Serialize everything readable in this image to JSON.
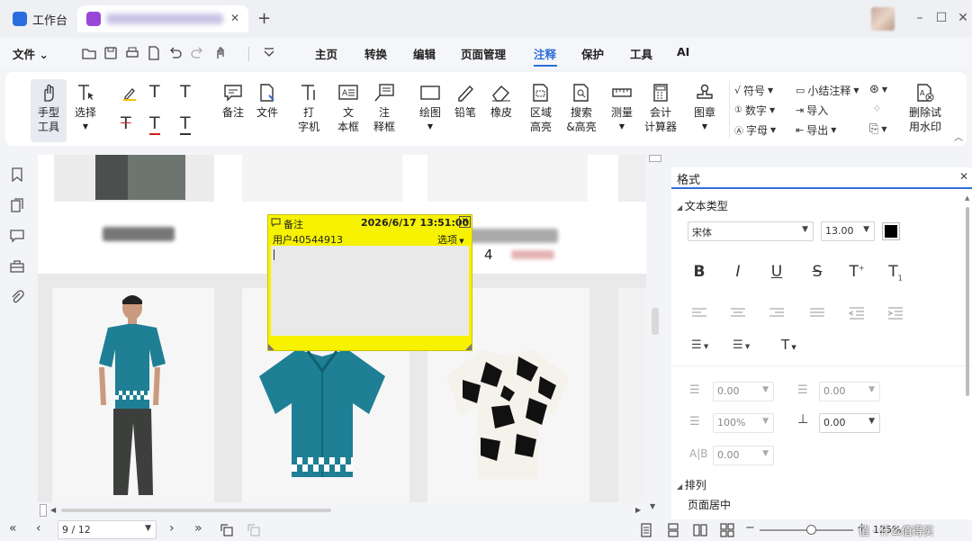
{
  "tabs": [
    {
      "label": "工作台",
      "active": false
    },
    {
      "label": "",
      "active": true,
      "close": "✕"
    }
  ],
  "new_tab": "+",
  "window": {
    "minimize": "–",
    "maximize": "☐",
    "close": "✕"
  },
  "menu": {
    "file": "文件",
    "items": [
      "主页",
      "转换",
      "编辑",
      "页面管理",
      "注释",
      "保护",
      "工具",
      "AI"
    ],
    "active": "注释"
  },
  "ribbon": {
    "hand_tool": [
      "手型",
      "工具"
    ],
    "select": "选择",
    "note": "备注",
    "file": "文件",
    "typewriter": [
      "打",
      "字机"
    ],
    "textbox": [
      "文",
      "本框"
    ],
    "callout": [
      "注",
      "释框"
    ],
    "drawing": "绘图",
    "pencil": "铅笔",
    "eraser": "橡皮",
    "area_highlight": [
      "区域",
      "高亮"
    ],
    "search_highlight": [
      "搜索",
      "&高亮"
    ],
    "measure": "测量",
    "accounting": [
      "会计",
      "计算器"
    ],
    "stamp": "图章",
    "symbol": "符号",
    "number": "数字",
    "letter": "字母",
    "summary": "小结注释",
    "import": "导入",
    "export": "导出",
    "remove_watermark": [
      "删除试",
      "用水印"
    ]
  },
  "note": {
    "title": "备注",
    "timestamp": "2026/6/17 13:51:00",
    "user": "用户40544913",
    "options": "选项",
    "close": "✕"
  },
  "doc_text": {
    "number": "4"
  },
  "panel": {
    "title": "格式",
    "close": "✕",
    "section_text_type": "文本类型",
    "font": "宋体",
    "font_size": "13.00",
    "font_color": "#000000",
    "styles": [
      "B",
      "I",
      "U",
      "S",
      "T",
      "T"
    ],
    "indent_left": "0.00",
    "indent_right": "0.00",
    "line_spacing": "100%",
    "para_spacing": "0.00",
    "char_spacing": "0.00",
    "section_arrange": "排列",
    "page_center": "页面居中"
  },
  "status": {
    "page": "9 / 12",
    "zoom": "125%",
    "zoom_fraction": 0.55,
    "watermark": "值 · 什么值得买"
  },
  "colors": {
    "accent": "#2f6fd8",
    "note_yellow": "#f7f200",
    "tab_logo_1": "#2b6de0",
    "tab_logo_2": "#9a46d8"
  }
}
